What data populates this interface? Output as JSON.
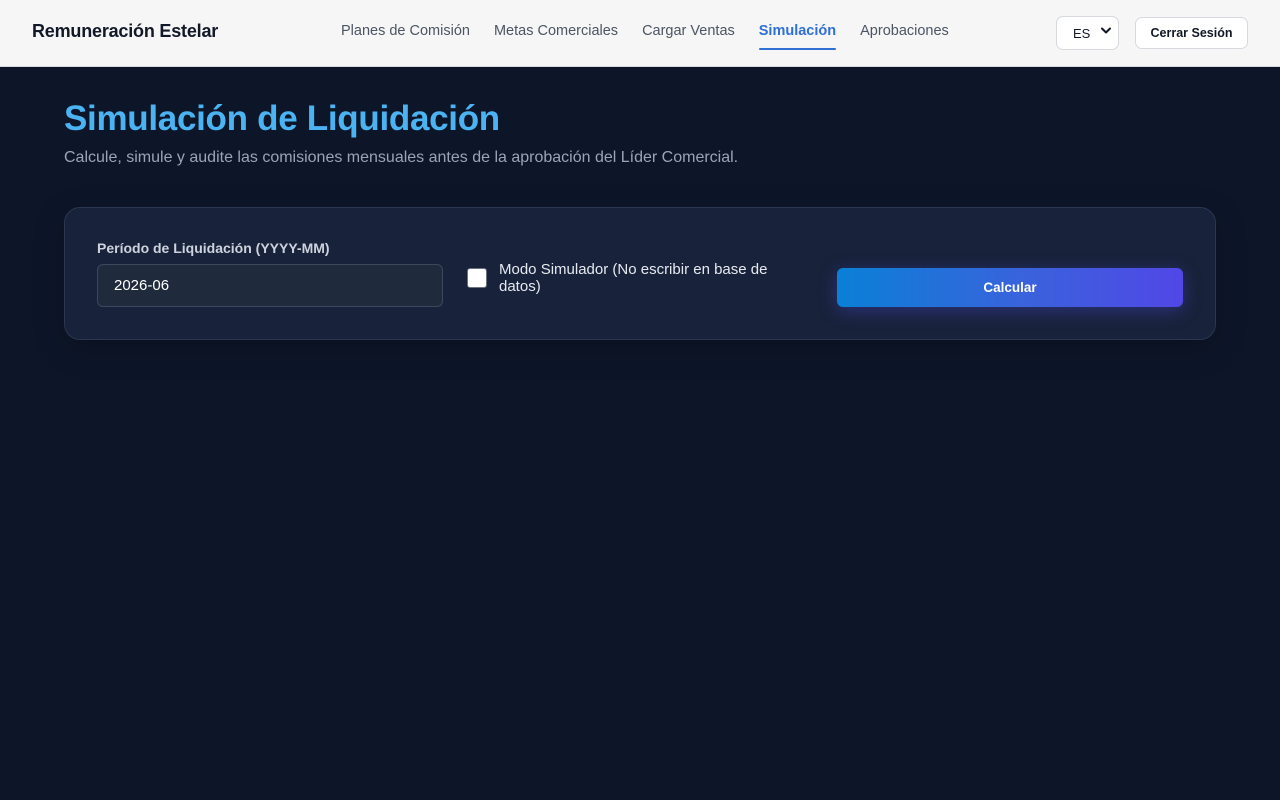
{
  "header": {
    "brand": "Remuneración Estelar",
    "nav": [
      {
        "label": "Planes de Comisión",
        "active": false
      },
      {
        "label": "Metas Comerciales",
        "active": false
      },
      {
        "label": "Cargar Ventas",
        "active": false
      },
      {
        "label": "Simulación",
        "active": true
      },
      {
        "label": "Aprobaciones",
        "active": false
      }
    ],
    "language": {
      "selected": "ES"
    },
    "logout_label": "Cerrar Sesión"
  },
  "page": {
    "title": "Simulación de Liquidación",
    "subtitle": "Calcule, simule y audite las comisiones mensuales antes de la aprobación del Líder Comercial."
  },
  "form": {
    "period_label": "Período de Liquidación (YYYY-MM)",
    "period_value": "2026-06",
    "simulator_label": "Modo Simulador (No escribir en base de datos)",
    "simulator_checked": false,
    "calculate_label": "Calcular"
  },
  "colors": {
    "background": "#0d1629",
    "accent": "#2f6fd6",
    "title": "#4cb3f2",
    "card": "#18223a"
  }
}
